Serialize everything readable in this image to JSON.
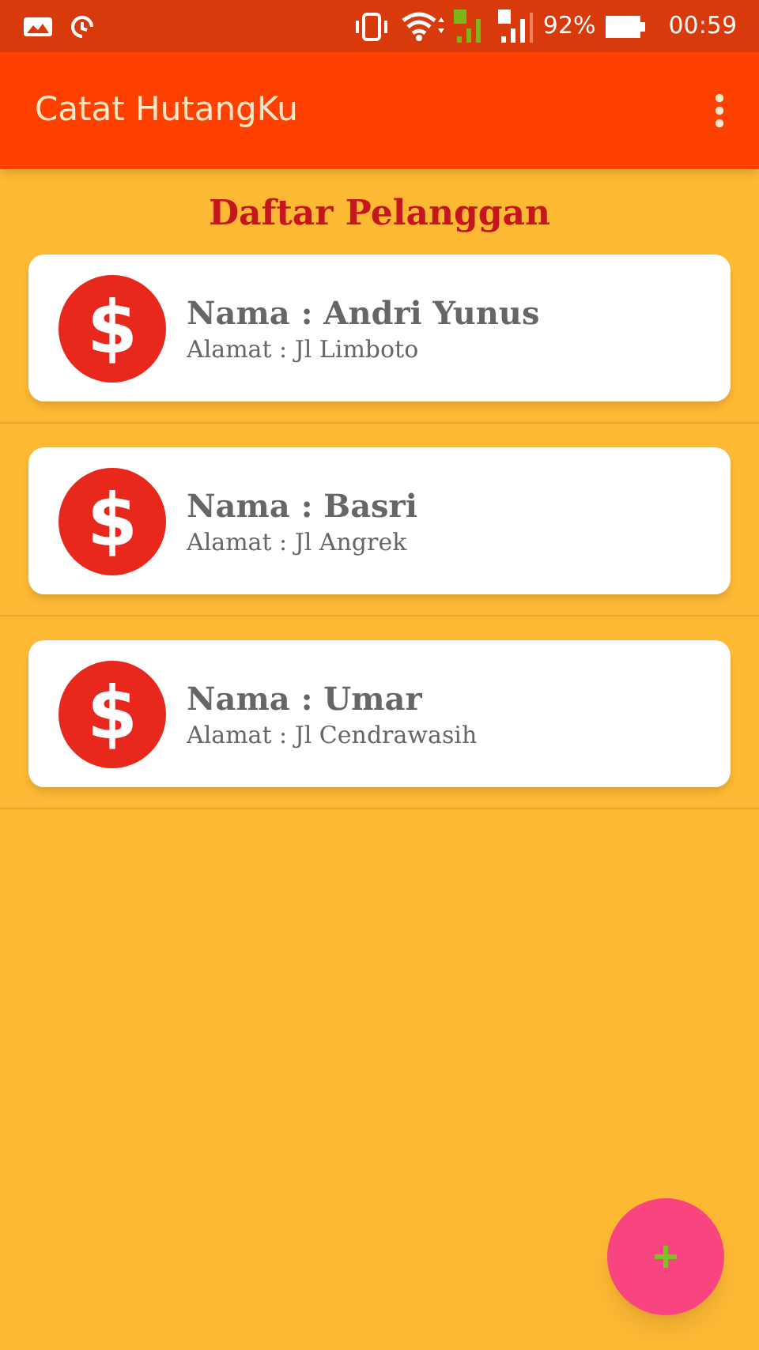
{
  "status_bar": {
    "battery": "92%",
    "time": "00:59"
  },
  "app_bar": {
    "title": "Catat HutangKu"
  },
  "heading": "Daftar Pelanggan",
  "customers": [
    {
      "icon": "$",
      "name": "Nama : Andri Yunus",
      "address": "Alamat : Jl Limboto"
    },
    {
      "icon": "$",
      "name": "Nama : Basri",
      "address": "Alamat : Jl Angrek"
    },
    {
      "icon": "$",
      "name": "Nama : Umar",
      "address": "Alamat : Jl Cendrawasih"
    }
  ]
}
